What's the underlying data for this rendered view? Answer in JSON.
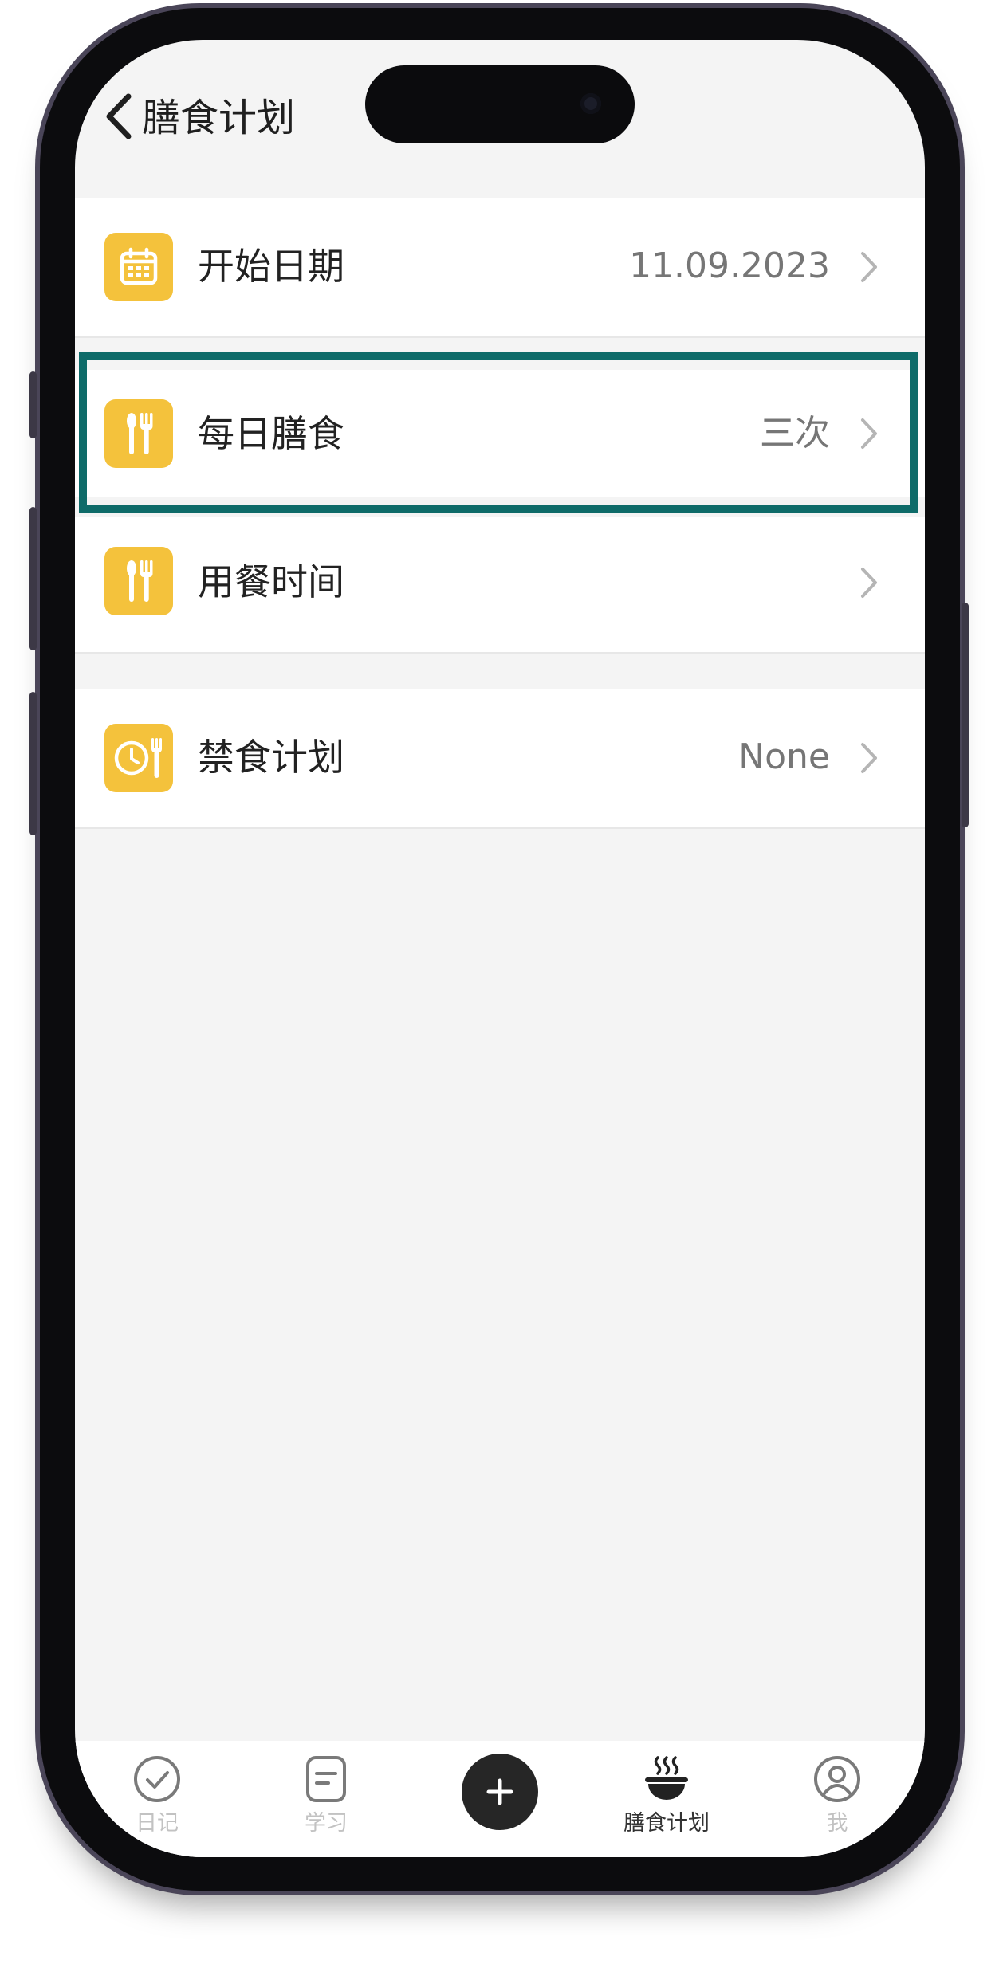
{
  "nav": {
    "title": "膳食计划"
  },
  "rows": [
    {
      "label": "开始日期",
      "value": "11.09.2023",
      "icon": "calendar-icon"
    },
    {
      "label": "每日膳食",
      "value": "三次",
      "icon": "fork-spoon-icon"
    },
    {
      "label": "用餐时间",
      "value": "",
      "icon": "fork-spoon-icon"
    },
    {
      "label": "禁食计划",
      "value": "None",
      "icon": "clock-utensils-icon"
    }
  ],
  "tabs": [
    {
      "label": "日记",
      "icon": "check-circle-icon",
      "active": false
    },
    {
      "label": "学习",
      "icon": "document-icon",
      "active": false
    },
    {
      "label": "",
      "icon": "plus-icon",
      "active": false
    },
    {
      "label": "膳食计划",
      "icon": "steaming-bowl-icon",
      "active": true
    },
    {
      "label": "我",
      "icon": "user-circle-icon",
      "active": false
    }
  ],
  "colors": {
    "accent_icon": "#f4c23c",
    "highlight": "#0e6b69",
    "background": "#f4f4f4",
    "tab_inactive": "#c2c2c2",
    "tab_active": "#333333"
  }
}
